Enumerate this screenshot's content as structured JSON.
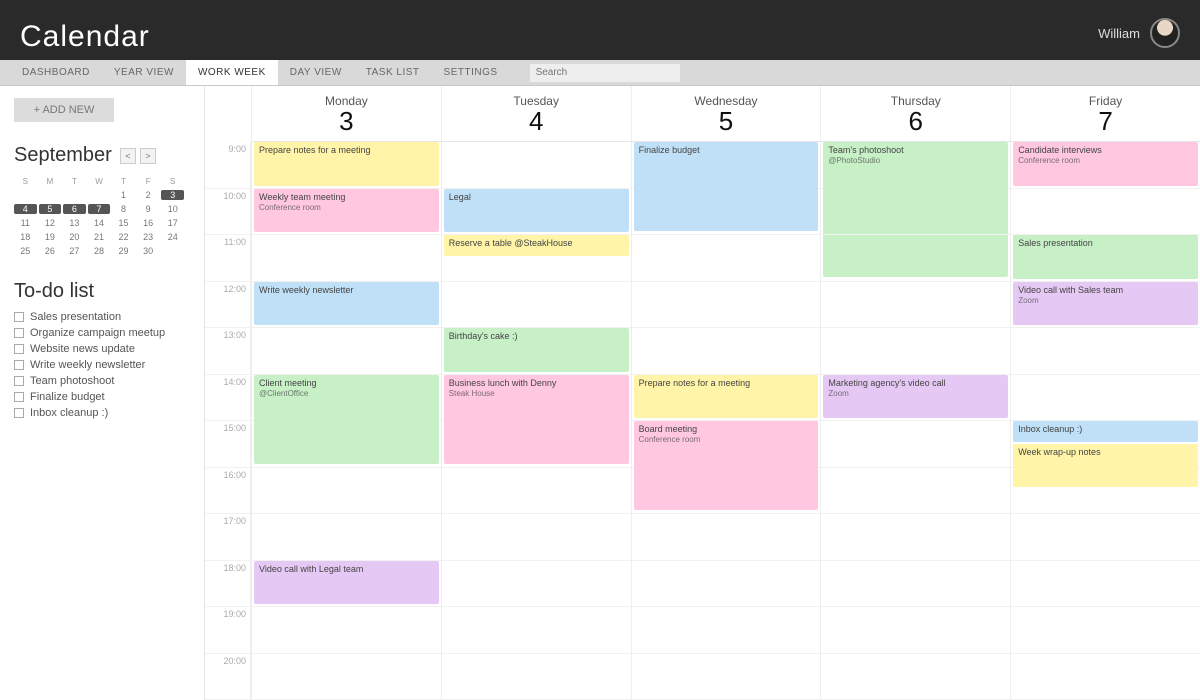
{
  "header": {
    "title": "Calendar",
    "user_name": "William"
  },
  "tabs": {
    "items": [
      "DASHBOARD",
      "YEAR VIEW",
      "WORK WEEK",
      "DAY VIEW",
      "TASK LIST",
      "SETTINGS"
    ],
    "active_index": 2,
    "search_placeholder": "Search"
  },
  "sidebar": {
    "add_label": "+ ADD NEW",
    "month_name": "September",
    "dows": [
      "S",
      "M",
      "T",
      "W",
      "T",
      "F",
      "S"
    ],
    "days": [
      "",
      "",
      "",
      "",
      "1",
      "2",
      "3",
      "4",
      "5",
      "6",
      "7",
      "8",
      "9",
      "10",
      "11",
      "12",
      "13",
      "14",
      "15",
      "16",
      "17",
      "18",
      "19",
      "20",
      "21",
      "22",
      "23",
      "24",
      "25",
      "26",
      "27",
      "28",
      "29",
      "30",
      ""
    ],
    "selected_days": [
      "3",
      "4",
      "5",
      "6",
      "7"
    ],
    "todo_title": "To-do list",
    "todo_items": [
      "Sales presentation",
      "Organize campaign meetup",
      "Website news update",
      "Write weekly newsletter",
      "Team photoshoot",
      "Finalize budget",
      "Inbox cleanup :)"
    ]
  },
  "week": {
    "days": [
      {
        "name": "Monday",
        "num": "3"
      },
      {
        "name": "Tuesday",
        "num": "4"
      },
      {
        "name": "Wednesday",
        "num": "5"
      },
      {
        "name": "Thursday",
        "num": "6"
      },
      {
        "name": "Friday",
        "num": "7"
      }
    ],
    "hours": [
      "9:00",
      "10:00",
      "11:00",
      "12:00",
      "13:00",
      "14:00",
      "15:00",
      "16:00",
      "17:00",
      "18:00",
      "19:00",
      "20:00"
    ],
    "events": [
      {
        "day": 0,
        "start": 0,
        "span": 1,
        "color": "yellow",
        "title": "Prepare notes for a meeting",
        "sub": ""
      },
      {
        "day": 0,
        "start": 1,
        "span": 1,
        "color": "pink",
        "title": "Weekly team meeting",
        "sub": "Conference room"
      },
      {
        "day": 0,
        "start": 3,
        "span": 1,
        "color": "blue",
        "title": "Write weekly newsletter",
        "sub": ""
      },
      {
        "day": 0,
        "start": 5,
        "span": 2,
        "color": "green",
        "title": "Client meeting",
        "sub": "@ClientOffice"
      },
      {
        "day": 0,
        "start": 9,
        "span": 1,
        "color": "purple",
        "title": "Video call with Legal team",
        "sub": ""
      },
      {
        "day": 1,
        "start": 1,
        "span": 1,
        "color": "blue",
        "title": "Legal",
        "sub": ""
      },
      {
        "day": 1,
        "start": 2,
        "span": 0.5,
        "color": "yellow",
        "title": "Reserve a table @SteakHouse",
        "sub": ""
      },
      {
        "day": 1,
        "start": 4,
        "span": 1,
        "color": "green",
        "title": "Birthday's cake :)",
        "sub": ""
      },
      {
        "day": 1,
        "start": 5,
        "span": 2,
        "color": "pink",
        "title": "Business lunch with Denny",
        "sub": "Steak House"
      },
      {
        "day": 2,
        "start": 0,
        "span": 2,
        "color": "blue",
        "title": "Finalize budget",
        "sub": ""
      },
      {
        "day": 2,
        "start": 5,
        "span": 1,
        "color": "yellow",
        "title": "Prepare notes for a meeting",
        "sub": ""
      },
      {
        "day": 2,
        "start": 6,
        "span": 2,
        "color": "pink",
        "title": "Board meeting",
        "sub": "Conference room"
      },
      {
        "day": 3,
        "start": 0,
        "span": 3,
        "color": "green",
        "title": "Team's photoshoot",
        "sub": "@PhotoStudio"
      },
      {
        "day": 3,
        "start": 5,
        "span": 1,
        "color": "purple",
        "title": "Marketing agency's video call",
        "sub": "Zoom"
      },
      {
        "day": 4,
        "start": 0,
        "span": 1,
        "color": "pink",
        "title": "Candidate interviews",
        "sub": "Conference room"
      },
      {
        "day": 4,
        "start": 2,
        "span": 1,
        "color": "green",
        "title": "Sales presentation",
        "sub": ""
      },
      {
        "day": 4,
        "start": 3,
        "span": 1,
        "color": "purple",
        "title": "Video call with Sales team",
        "sub": "Zoom"
      },
      {
        "day": 4,
        "start": 6,
        "span": 0.5,
        "color": "blue",
        "title": "Inbox cleanup :)",
        "sub": ""
      },
      {
        "day": 4,
        "start": 6.5,
        "span": 1,
        "color": "yellow",
        "title": "Week wrap-up notes",
        "sub": ""
      }
    ]
  }
}
